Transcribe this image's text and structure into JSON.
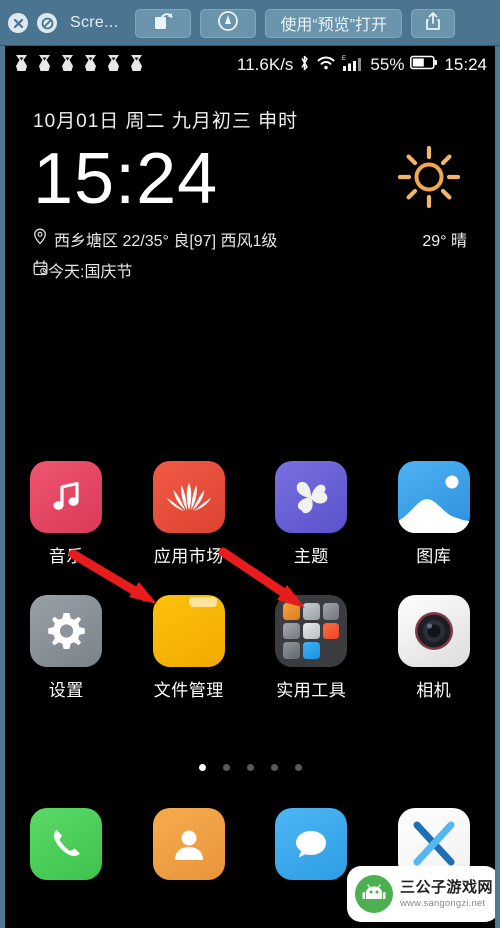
{
  "quicklook": {
    "close_icon": "close-circle-icon",
    "block_icon": "no-entry-circle-icon",
    "title": "Scre...",
    "rotate_button": "rotate-icon",
    "markup_button": "markup-pen-icon",
    "open_with_label": "使用“预览”打开",
    "share_button": "share-icon"
  },
  "statusbar": {
    "notification_icons": [
      "notification-icon",
      "notification-icon",
      "notification-icon",
      "notification-icon",
      "notification-icon",
      "notification-icon"
    ],
    "network_speed": "11.6K/s",
    "bluetooth_icon": "bluetooth-icon",
    "wifi_icon": "wifi-icon",
    "signal_icon": "signal-bars-icon",
    "signal_label": "E",
    "battery_percent": "55%",
    "battery_icon": "battery-icon",
    "time": "15:24"
  },
  "widget": {
    "date_line": "10月01日 周二 九月初三 申时",
    "clock": "15:24",
    "weather_icon": "sun-icon",
    "location_icon": "location-pin-icon",
    "weather_line": "西乡塘区 22/35° 良[97] 西风1级",
    "weather_right": "29° 晴",
    "calendar_icon": "calendar-icon",
    "festival_line": "今天:国庆节"
  },
  "apps": {
    "rows": [
      [
        {
          "label": "音乐",
          "icon": "music-note-icon",
          "bg": "#e94a64",
          "bg2": "#d93a58"
        },
        {
          "label": "应用市场",
          "icon": "huawei-flower-icon",
          "bg": "#e84d3d",
          "bg2": "#dd4330"
        },
        {
          "label": "主题",
          "icon": "theme-flower-icon",
          "bg": "#6b63d8",
          "bg2": "#5b53cd"
        },
        {
          "label": "图库",
          "icon": "gallery-mountain-icon",
          "bg": "#3ea7ec",
          "bg2": "#2e97e0"
        }
      ],
      [
        {
          "label": "设置",
          "icon": "gear-icon",
          "bg": "#8e949b",
          "bg2": "#7c838b"
        },
        {
          "label": "文件管理",
          "icon": "folder-icon",
          "bg": "#f7b500",
          "bg2": "#f0ab00"
        },
        {
          "label": "实用工具",
          "icon": "app-folder-icon",
          "bg": "#3a3c40",
          "bg2": "#3a3c40"
        },
        {
          "label": "相机",
          "icon": "camera-lens-icon",
          "bg": "#f5f5f5",
          "bg2": "#e8e8e8"
        }
      ]
    ]
  },
  "pager": {
    "total": 5,
    "active": 1
  },
  "dock": [
    {
      "label": "电话",
      "icon": "phone-icon",
      "bg": "#4cd05a"
    },
    {
      "label": "联系人",
      "icon": "contacts-person-icon",
      "bg": "#f0a042"
    },
    {
      "label": "信息",
      "icon": "message-bubble-icon",
      "bg": "#3aaaf0"
    },
    {
      "label": "浏览器",
      "icon": "x-browser-icon",
      "bg": "#ffffff"
    }
  ],
  "annotations": {
    "arrow_color": "#e81c1c",
    "arrows": [
      "arrow-to-file-manager",
      "arrow-to-tools-folder"
    ]
  },
  "watermark": {
    "site_name": "三公子游戏网",
    "url": "www.sangongzi.net",
    "logo_icon": "android-robot-icon"
  }
}
